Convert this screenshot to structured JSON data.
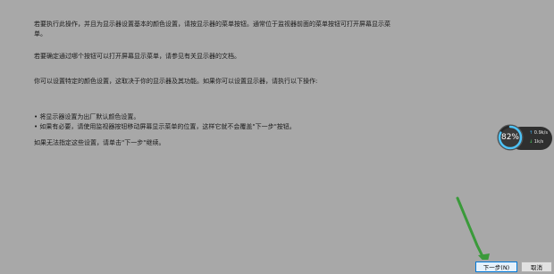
{
  "instructions": {
    "paragraph1": "若要执行此操作，并且为显示器设置基本的颜色设置，请按显示器的菜单按钮。通常位于监视器前面的菜单按钮可打开屏幕显示菜单。",
    "paragraph2": "若要确定通过哪个按钮可以打开屏幕显示菜单，请参见有关显示器的文档。",
    "paragraph3": "你可以设置特定的颜色设置，这取决于你的显示器及其功能。如果你可以设置显示器，请执行以下操作:",
    "bullet1": "• 将显示器设置为出厂默认颜色设置。",
    "bullet2": "• 如果有必要，请使用监视器按钮移动屏幕显示菜单的位置，这样它就不会覆盖\"下一步\"按钮。",
    "paragraph4": "如果无法指定这些设置，请单击\"下一步\"继续。"
  },
  "buttons": {
    "next_label": "下一步(N)",
    "cancel_label": "取消"
  },
  "widget": {
    "percent": "82%",
    "upload_speed": "0.9k/s",
    "download_speed": "1k/s",
    "level": 0.82,
    "gauge_color": "#4fc3f7"
  },
  "colors": {
    "background": "#a8a8a8",
    "annotation_arrow": "#3a9a3a"
  }
}
